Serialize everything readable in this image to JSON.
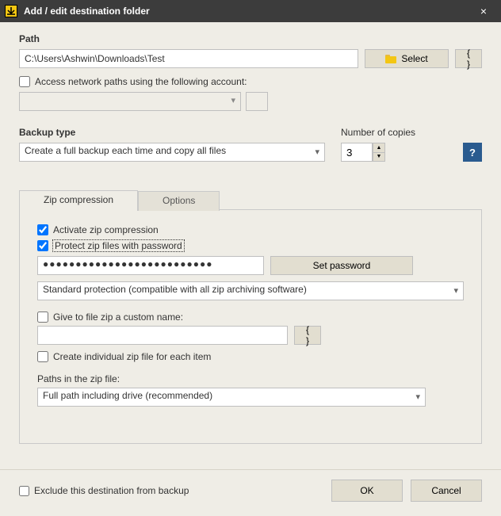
{
  "window": {
    "title": "Add / edit destination folder",
    "close_glyph": "×"
  },
  "path": {
    "label": "Path",
    "value": "C:\\Users\\Ashwin\\Downloads\\Test",
    "select_btn": "Select",
    "brace_btn": "{ }"
  },
  "network": {
    "checkbox_label": "Access network paths using the following account:"
  },
  "backup": {
    "type_label": "Backup type",
    "type_value": "Create a full backup each time and copy all files",
    "copies_label": "Number of copies",
    "copies_value": "3",
    "help_glyph": "?"
  },
  "tabs": {
    "zip": "Zip compression",
    "options": "Options"
  },
  "zip": {
    "activate_label": "Activate zip compression",
    "protect_label": "Protect zip files with password",
    "password_mask": "●●●●●●●●●●●●●●●●●●●●●●●●●●",
    "setpw_btn": "Set password",
    "protection_value": "Standard protection (compatible with all zip archiving software)",
    "customname_label": "Give to file zip a custom name:",
    "brace_btn": "{ }",
    "individual_label": "Create individual zip file for each item",
    "paths_label": "Paths in the zip file:",
    "paths_value": "Full path including drive (recommended)"
  },
  "footer": {
    "exclude_label": "Exclude this destination from backup",
    "ok": "OK",
    "cancel": "Cancel"
  }
}
